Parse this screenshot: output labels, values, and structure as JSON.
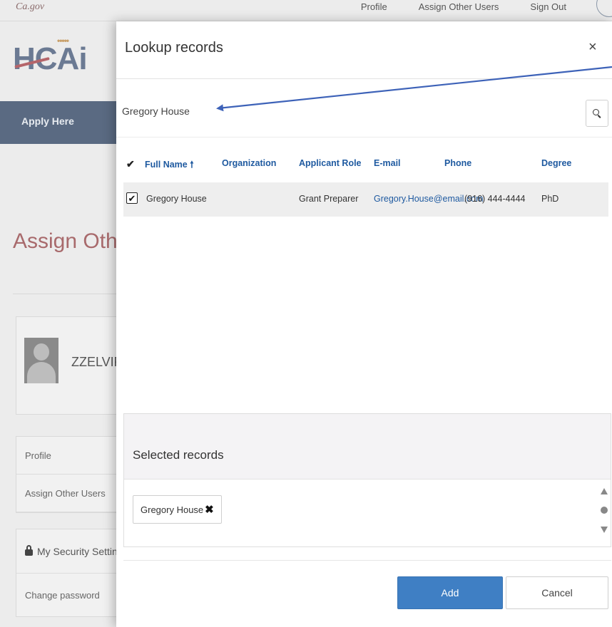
{
  "background": {
    "ca_logo": "Ca.gov",
    "top_nav": [
      "Profile",
      "Assign Other Users",
      "Sign Out"
    ],
    "brand": "HCAi",
    "apply_here": "Apply Here",
    "page_title": "Assign Other",
    "username": "ZZELVIR",
    "menu_items": [
      "Profile",
      "Assign Other Users"
    ],
    "security_header": "My Security Settings",
    "security_items": [
      "Change password"
    ]
  },
  "modal": {
    "title": "Lookup records",
    "close": "×",
    "search": {
      "value": "Gregory House",
      "placeholder": ""
    },
    "columns": {
      "check": "✔",
      "full_name": "Full Name",
      "sort_icon": "🠕",
      "organization": "Organization",
      "applicant_role": "Applicant Role",
      "email": "E-mail",
      "phone": "Phone",
      "degree": "Degree"
    },
    "rows": [
      {
        "checked": "✔",
        "full_name": "Gregory House",
        "organization": "",
        "applicant_role": "Grant Preparer",
        "email": "Gregory.House@email.com",
        "phone": "(916) 444-4444",
        "degree": "PhD"
      }
    ],
    "selected": {
      "title": "Selected records",
      "chips": [
        {
          "label": "Gregory House",
          "remove": "✖"
        }
      ]
    },
    "buttons": {
      "add": "Add",
      "cancel": "Cancel"
    }
  },
  "colors": {
    "accent_blue": "#3f7fc4",
    "link_blue": "#1f5aa0",
    "annotation_arrow": "#3d62b8"
  }
}
